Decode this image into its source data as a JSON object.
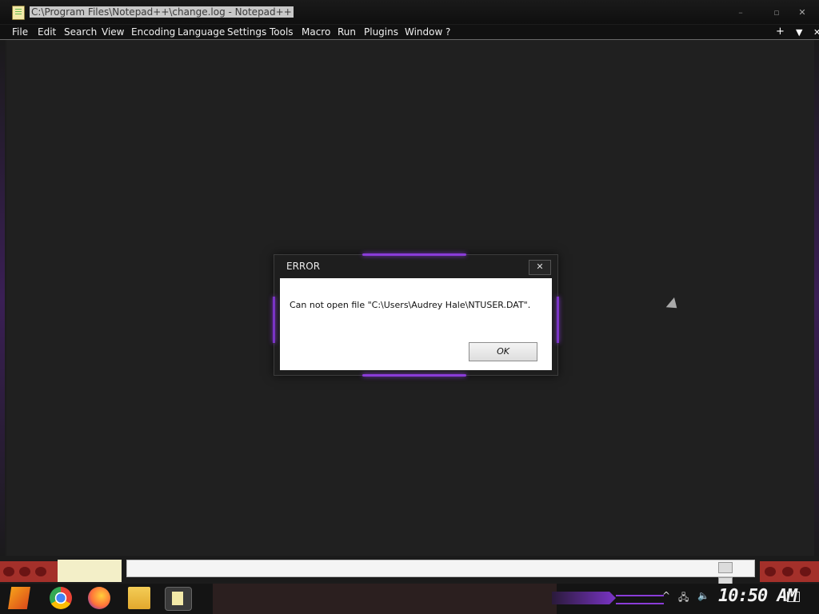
{
  "window": {
    "title": "C:\\Program Files\\Notepad++\\change.log - Notepad++",
    "min_symbol": "–",
    "max_symbol": "▫",
    "close_symbol": "✕"
  },
  "menu": {
    "items": [
      "File",
      "Edit",
      "Search",
      "View",
      "Encoding",
      "Language",
      "Settings",
      "Tools",
      "Macro",
      "Run",
      "Plugins",
      "Window",
      "?"
    ],
    "right_plus": "+",
    "right_down": "▼",
    "right_close": "✕"
  },
  "dialog": {
    "title": "ERROR",
    "close": "✕",
    "message": "Can not open file \"C:\\Users\\Audrey Hale\\NTUSER.DAT\".",
    "ok_label": "OK"
  },
  "taskbar": {
    "clock": "10:50 AM",
    "tray_up": "^"
  },
  "colors": {
    "accent": "#8a3cd8",
    "background": "#1c1c1c"
  }
}
